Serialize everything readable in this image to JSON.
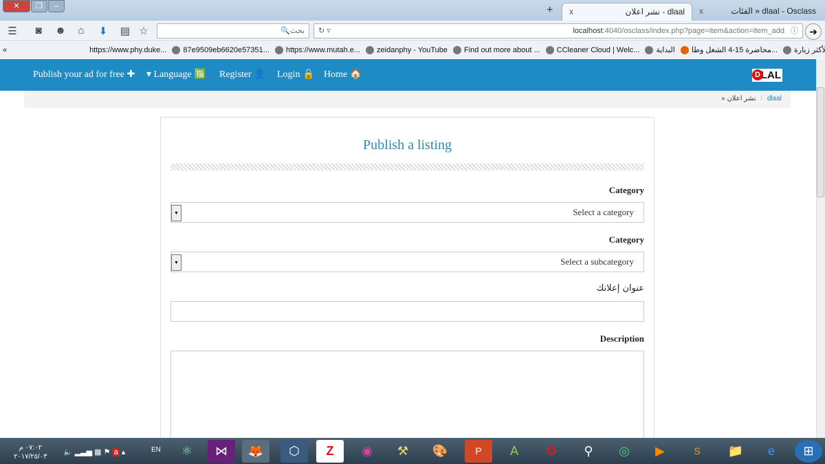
{
  "browser": {
    "tabs": [
      {
        "label": "dlaal - نشر اعلان",
        "active": true
      },
      {
        "label": "dlaal - Osclass « الفئات",
        "active": false
      }
    ],
    "new_tab": "+",
    "close": "x",
    "search_placeholder": "بحث",
    "url_host": "localhost",
    "url_rest": ":4040/osclass/index.php?page=item&action=item_add",
    "bookmarks": [
      "https://www.phy.duke...",
      "87e9509eb6620e57351...",
      "https://www.mutah.e...",
      "zeidanphy - YouTube",
      "Find out more about ...",
      "CCleaner Cloud | Welc...",
      "البداية",
      "محاضرة 15-4 الشغل وطا...",
      "الأكثر زيارة"
    ],
    "bookmarks_overflow": "«"
  },
  "site": {
    "nav": [
      "Publish your ad for free ✚",
      "▾ Language 🈯",
      "Register 👤",
      "Login 🔒",
      "Home 🏠"
    ],
    "logo": "DLAL",
    "breadcrumb": {
      "home": "dlaal",
      "sep": "/",
      "current": "» نشر اعلان"
    }
  },
  "form": {
    "title": "Publish a listing",
    "category_label": "Category",
    "category_placeholder": "Select a category",
    "subcategory_label": "Category",
    "subcategory_placeholder": "Select a subcategory",
    "title_label": "عنوان إعلانك",
    "description_label": "Description"
  },
  "taskbar": {
    "time": "٠٧:٠٢ م",
    "date": "٢٠١٧/٢٥/٠٣",
    "lang": "EN"
  }
}
